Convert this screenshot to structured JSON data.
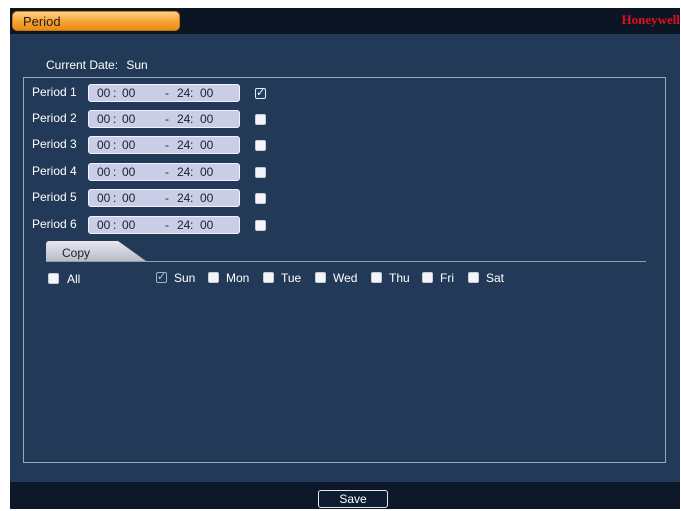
{
  "window": {
    "title": "Period",
    "brand": "Honeywell"
  },
  "current_date": {
    "label": "Current Date:",
    "value": "Sun"
  },
  "periods": [
    {
      "label": "Period 1",
      "start_h": "00",
      "start_m": "00",
      "end_h": "24",
      "end_m": "00",
      "enabled": true
    },
    {
      "label": "Period 2",
      "start_h": "00",
      "start_m": "00",
      "end_h": "24",
      "end_m": "00",
      "enabled": false
    },
    {
      "label": "Period 3",
      "start_h": "00",
      "start_m": "00",
      "end_h": "24",
      "end_m": "00",
      "enabled": false
    },
    {
      "label": "Period 4",
      "start_h": "00",
      "start_m": "00",
      "end_h": "24",
      "end_m": "00",
      "enabled": false
    },
    {
      "label": "Period 5",
      "start_h": "00",
      "start_m": "00",
      "end_h": "24",
      "end_m": "00",
      "enabled": false
    },
    {
      "label": "Period 6",
      "start_h": "00",
      "start_m": "00",
      "end_h": "24",
      "end_m": "00",
      "enabled": false
    }
  ],
  "time_separators": {
    "colon": ":",
    "dash": "-"
  },
  "copy": {
    "tab_label": "Copy",
    "all_label": "All",
    "all_checked": false,
    "days": [
      {
        "label": "Sun",
        "checked": true
      },
      {
        "label": "Mon",
        "checked": false
      },
      {
        "label": "Tue",
        "checked": false
      },
      {
        "label": "Wed",
        "checked": false
      },
      {
        "label": "Thu",
        "checked": false
      },
      {
        "label": "Fri",
        "checked": false
      },
      {
        "label": "Sat",
        "checked": false
      }
    ]
  },
  "footer": {
    "save_label": "Save"
  },
  "colors": {
    "background": "#223a57",
    "title_tab": "#f7a233",
    "brand": "#e0101c",
    "field": "#c9cde6"
  }
}
